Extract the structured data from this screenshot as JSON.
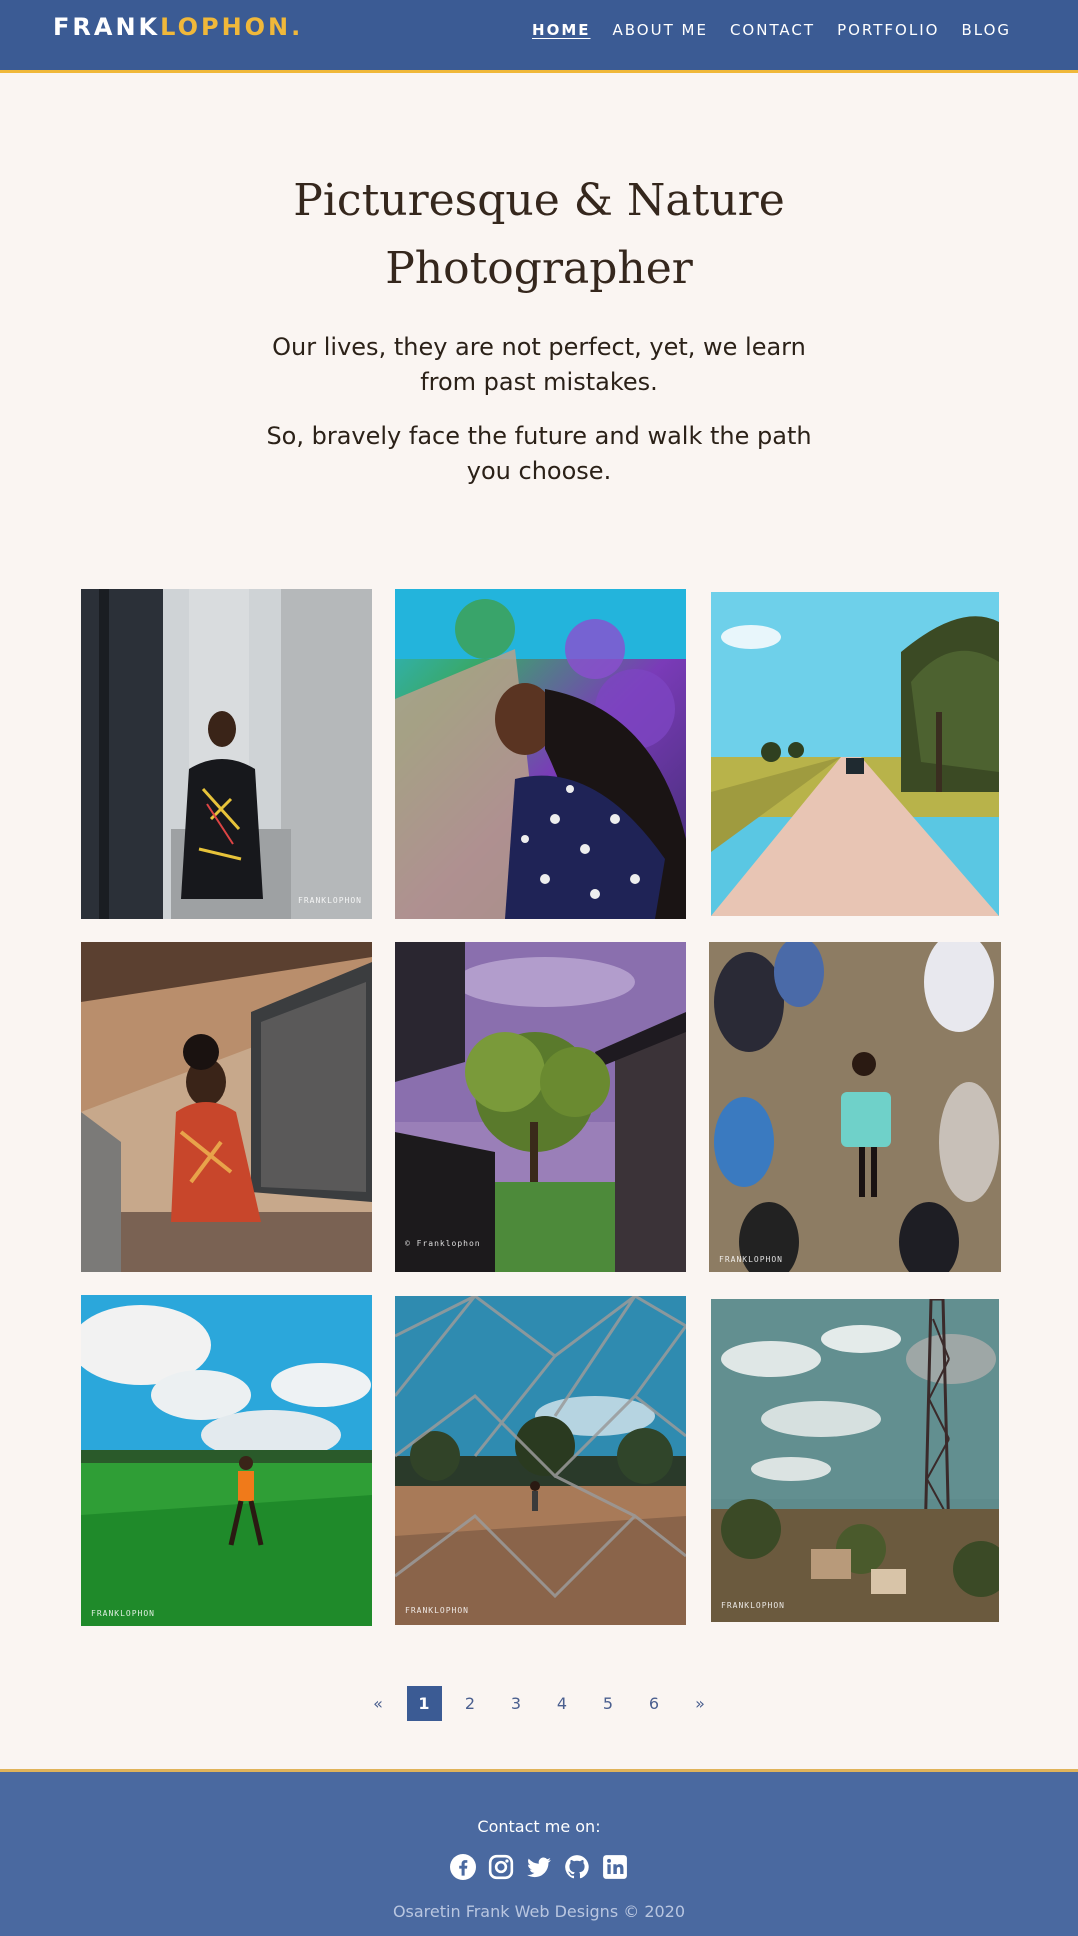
{
  "header": {
    "logo_part1": "FRANK",
    "logo_part2": "LOPHON.",
    "nav": [
      "HOME",
      "ABOUT ME",
      "CONTACT",
      "PORTFOLIO",
      "BLOG"
    ]
  },
  "hero": {
    "title_line1": "Picturesque & Nature",
    "title_line2": "Photographer",
    "paragraph1": "Our lives, they are not perfect, yet, we learn from past mistakes.",
    "paragraph2": "So, bravely face the future and walk the path you choose."
  },
  "gallery": {
    "watermarks": [
      "FRANKLOPHON",
      "© Franklophon",
      "FRANKLOPHON",
      "FRANKLOPHON",
      "FRANKLOPHON",
      "FRANKLOPHON"
    ]
  },
  "pagination": {
    "prev": "«",
    "pages": [
      "1",
      "2",
      "3",
      "4",
      "5",
      "6"
    ],
    "next": "»",
    "current": "1"
  },
  "footer": {
    "contact_label": "Contact me on:",
    "social_icons": [
      "facebook-icon",
      "instagram-icon",
      "twitter-icon",
      "github-icon",
      "linkedin-icon"
    ],
    "copyright": "Osaretin Frank Web Designs © 2020"
  },
  "colors": {
    "header_bg": "#3b5b94",
    "accent": "#f0b83a",
    "page_bg": "#faf5f2",
    "footer_bg": "#4a69a0"
  }
}
